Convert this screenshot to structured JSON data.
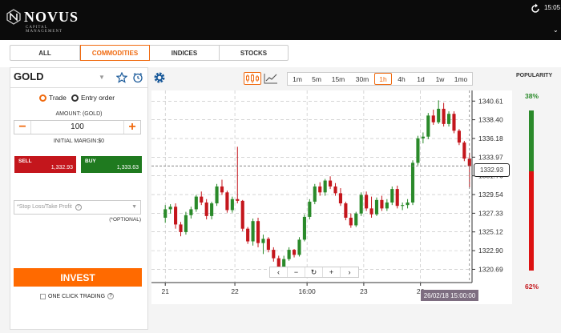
{
  "brand": {
    "name": "NOVUS",
    "tagline": "CAPITAL MANAGEMENT"
  },
  "status": {
    "time": "15:05"
  },
  "tabs": [
    {
      "label": "ALL",
      "active": false
    },
    {
      "label": "COMMODITIES",
      "active": true
    },
    {
      "label": "INDICES",
      "active": false
    },
    {
      "label": "STOCKS",
      "active": false
    }
  ],
  "trade_panel": {
    "asset": "GOLD",
    "mode_trade": "Trade",
    "mode_entry": "Entry order",
    "amount_label": "AMOUNT: (GOLD)",
    "amount_value": "100",
    "margin_label": "INITIAL MARGIN:$0",
    "sell_label": "SELL",
    "sell_price": "1,332.93",
    "buy_label": "BUY",
    "buy_price": "1,333.63",
    "stop_loss_placeholder": "*Stop Loss/Take Profit",
    "optional_label": "(*OPTIONAL)",
    "invest_label": "INVEST",
    "one_click_label": "ONE CLICK TRADING"
  },
  "timeframes": [
    {
      "label": "1m",
      "active": false
    },
    {
      "label": "5m",
      "active": false
    },
    {
      "label": "15m",
      "active": false
    },
    {
      "label": "30m",
      "active": false
    },
    {
      "label": "1h",
      "active": true
    },
    {
      "label": "4h",
      "active": false
    },
    {
      "label": "1d",
      "active": false
    },
    {
      "label": "1w",
      "active": false
    },
    {
      "label": "1mo",
      "active": false
    }
  ],
  "popularity": {
    "label": "POPULARITY",
    "buy_pct_label": "38%",
    "sell_pct_label": "62%",
    "buy_fraction": 0.38
  },
  "colors": {
    "accent": "#f06a0f",
    "up": "#2a8a2a",
    "down": "#c4161c"
  },
  "icons": [
    "star-icon",
    "alarm-clock-icon",
    "gear-icon",
    "candlestick-icon",
    "line-chart-icon",
    "sync-icon"
  ],
  "chart_data": {
    "type": "candlestick",
    "y_ticks": [
      "1340.61",
      "1338.40",
      "1336.18",
      "1333.97",
      "1331.76",
      "1329.54",
      "1327.33",
      "1325.12",
      "1322.90",
      "1320.69"
    ],
    "x_ticks": [
      "21",
      "22",
      "16:00",
      "23",
      "26"
    ],
    "ylim": [
      1319.5,
      1341.3
    ],
    "current_price": "1332.93",
    "current_price_value": 1332.93,
    "crosshair_date": "26/02/18 15:00:00",
    "grid": true,
    "candles_ohlc": [
      [
        1326.8,
        1328.3,
        1326.2,
        1327.8
      ],
      [
        1327.8,
        1328.4,
        1327.3,
        1328.1
      ],
      [
        1328.1,
        1328.5,
        1325.5,
        1326.0
      ],
      [
        1326.0,
        1326.3,
        1324.6,
        1325.1
      ],
      [
        1325.1,
        1327.5,
        1324.8,
        1327.1
      ],
      [
        1327.1,
        1328.1,
        1326.7,
        1327.8
      ],
      [
        1327.8,
        1329.5,
        1327.5,
        1329.3
      ],
      [
        1329.3,
        1329.9,
        1328.3,
        1328.6
      ],
      [
        1328.6,
        1329.0,
        1326.6,
        1327.0
      ],
      [
        1327.0,
        1328.7,
        1326.6,
        1328.5
      ],
      [
        1328.5,
        1330.8,
        1328.2,
        1330.5
      ],
      [
        1330.5,
        1331.3,
        1329.5,
        1329.8
      ],
      [
        1329.8,
        1330.0,
        1327.4,
        1327.7
      ],
      [
        1327.7,
        1329.3,
        1327.4,
        1329.0
      ],
      [
        1329.0,
        1335.2,
        1328.5,
        1328.8
      ],
      [
        1328.8,
        1328.9,
        1325.2,
        1325.5
      ],
      [
        1325.5,
        1325.7,
        1323.7,
        1324.0
      ],
      [
        1324.0,
        1326.7,
        1323.5,
        1326.4
      ],
      [
        1326.4,
        1326.8,
        1323.3,
        1323.8
      ],
      [
        1323.8,
        1324.8,
        1322.5,
        1324.3
      ],
      [
        1324.3,
        1324.5,
        1322.7,
        1323.0
      ],
      [
        1323.0,
        1323.3,
        1321.6,
        1322.0
      ],
      [
        1322.0,
        1322.3,
        1320.6,
        1321.0
      ],
      [
        1321.0,
        1322.3,
        1320.7,
        1321.9
      ],
      [
        1321.9,
        1323.3,
        1321.7,
        1323.0
      ],
      [
        1323.0,
        1323.1,
        1322.1,
        1322.4
      ],
      [
        1322.4,
        1324.5,
        1322.2,
        1324.2
      ],
      [
        1324.2,
        1327.2,
        1324.0,
        1326.9
      ],
      [
        1326.9,
        1329.0,
        1326.6,
        1328.7
      ],
      [
        1328.7,
        1330.8,
        1328.4,
        1330.5
      ],
      [
        1330.5,
        1331.0,
        1329.4,
        1329.8
      ],
      [
        1329.8,
        1331.4,
        1329.4,
        1331.2
      ],
      [
        1331.2,
        1331.7,
        1330.2,
        1330.5
      ],
      [
        1330.5,
        1330.9,
        1329.4,
        1329.7
      ],
      [
        1329.7,
        1330.3,
        1328.2,
        1328.5
      ],
      [
        1328.5,
        1328.7,
        1326.5,
        1326.8
      ],
      [
        1326.8,
        1327.3,
        1325.6,
        1325.9
      ],
      [
        1325.9,
        1327.5,
        1325.7,
        1327.3
      ],
      [
        1327.3,
        1329.8,
        1327.0,
        1329.5
      ],
      [
        1329.5,
        1329.9,
        1327.6,
        1327.9
      ],
      [
        1327.9,
        1329.3,
        1326.8,
        1327.2
      ],
      [
        1327.2,
        1329.2,
        1327.0,
        1328.9
      ],
      [
        1328.9,
        1329.4,
        1327.6,
        1327.9
      ],
      [
        1327.9,
        1329.0,
        1327.6,
        1328.6
      ],
      [
        1328.6,
        1330.5,
        1328.3,
        1330.2
      ],
      [
        1330.2,
        1330.6,
        1327.9,
        1328.2
      ],
      [
        1328.2,
        1328.6,
        1327.7,
        1328.3
      ],
      [
        1328.3,
        1329.0,
        1327.9,
        1328.6
      ],
      [
        1328.6,
        1333.6,
        1328.3,
        1333.3
      ],
      [
        1333.3,
        1336.5,
        1333.0,
        1336.2
      ],
      [
        1336.2,
        1336.9,
        1335.6,
        1336.4
      ],
      [
        1336.4,
        1339.2,
        1336.1,
        1338.9
      ],
      [
        1338.9,
        1339.6,
        1337.8,
        1338.1
      ],
      [
        1338.1,
        1340.7,
        1337.9,
        1339.7
      ],
      [
        1339.7,
        1340.4,
        1337.6,
        1337.9
      ],
      [
        1337.9,
        1339.4,
        1337.6,
        1339.1
      ],
      [
        1339.1,
        1339.4,
        1336.8,
        1337.1
      ],
      [
        1337.1,
        1337.3,
        1335.4,
        1335.7
      ],
      [
        1335.7,
        1335.9,
        1333.5,
        1333.8
      ],
      [
        1333.8,
        1334.5,
        1330.4,
        1332.9
      ]
    ]
  }
}
